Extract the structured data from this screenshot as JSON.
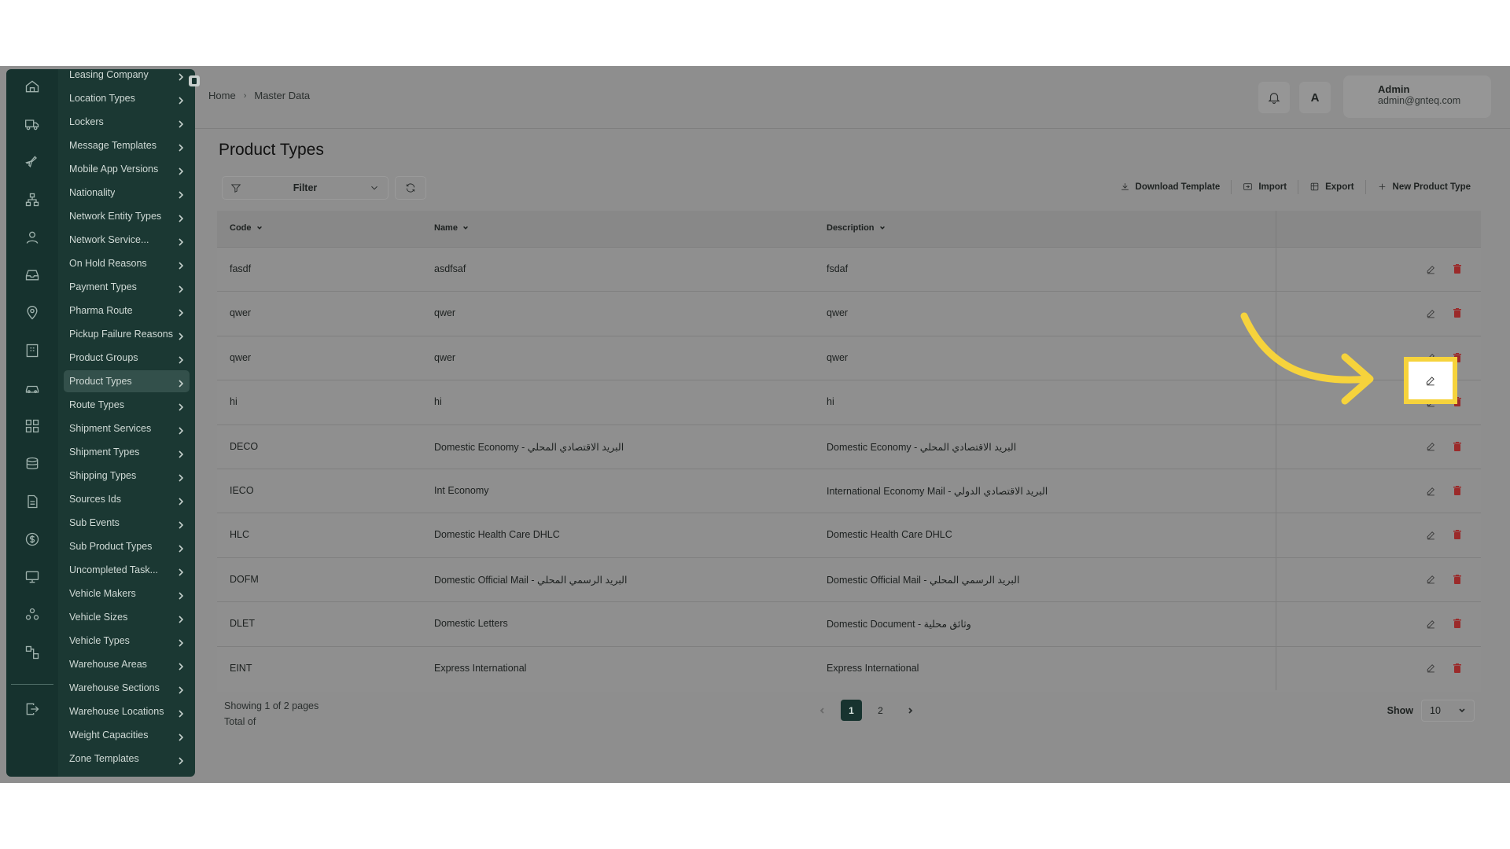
{
  "breadcrumb": [
    "Home",
    "Master Data"
  ],
  "user": {
    "name": "Admin",
    "email": "admin@gnteq.com"
  },
  "language_button": "A",
  "submenu": [
    "Leasing Company",
    "Location Types",
    "Lockers",
    "Message Templates",
    "Mobile App Versions",
    "Nationality",
    "Network Entity Types",
    "Network Service...",
    "On Hold Reasons",
    "Payment Types",
    "Pharma Route",
    "Pickup Failure Reasons",
    "Product Groups",
    "Product Types",
    "Route Types",
    "Shipment Services",
    "Shipment Types",
    "Shipping Types",
    "Sources Ids",
    "Sub Events",
    "Sub Product Types",
    "Uncompleted Task...",
    "Vehicle Makers",
    "Vehicle Sizes",
    "Vehicle Types",
    "Warehouse Areas",
    "Warehouse Sections",
    "Warehouse Locations",
    "Weight Capacities",
    "Zone Templates"
  ],
  "submenu_active": "Product Types",
  "rail_icons": [
    "home-icon",
    "truck-icon",
    "plane-icon",
    "network-icon",
    "user-icon",
    "inbox-icon",
    "location-icon",
    "building-icon",
    "car-icon",
    "grid-icon",
    "database-icon",
    "report-icon",
    "dollar-icon",
    "monitor-icon",
    "cluster-icon",
    "flow-icon",
    "logout-icon"
  ],
  "page": {
    "title": "Product Types",
    "filter_label": "Filter",
    "actions": {
      "download_template": "Download Template",
      "import": "Import",
      "export": "Export",
      "new": "New Product Type"
    }
  },
  "table": {
    "columns": [
      "Code",
      "Name",
      "Description"
    ],
    "rows": [
      [
        "fasdf",
        "asdfsaf",
        "fsdaf"
      ],
      [
        "qwer",
        "qwer",
        "qwer"
      ],
      [
        "qwer",
        "qwer",
        "qwer"
      ],
      [
        "hi",
        "hi",
        "hi"
      ],
      [
        "DECO",
        "Domestic Economy - البريد الاقتصادي المحلي",
        "Domestic Economy - البريد الاقتصادي المحلي"
      ],
      [
        "IECO",
        "Int Economy",
        "International Economy Mail - البريد الاقتصادي الدولي"
      ],
      [
        "HLC",
        "Domestic Health Care DHLC",
        "Domestic Health Care DHLC"
      ],
      [
        "DOFM",
        "Domestic Official Mail - البريد الرسمي المحلي",
        "Domestic Official Mail - البريد الرسمي المحلي"
      ],
      [
        "DLET",
        "Domestic Letters",
        "Domestic Document - وثائق محلية"
      ],
      [
        "EINT",
        "Express International",
        "Express International"
      ]
    ]
  },
  "footer": {
    "showing": "Showing 1 of 2 pages",
    "total": "Total of",
    "pages": [
      "1",
      "2"
    ],
    "current_page": "1",
    "show_label": "Show",
    "page_size": "10"
  },
  "highlight_color": "#f6d33c",
  "accent": "#17332f"
}
